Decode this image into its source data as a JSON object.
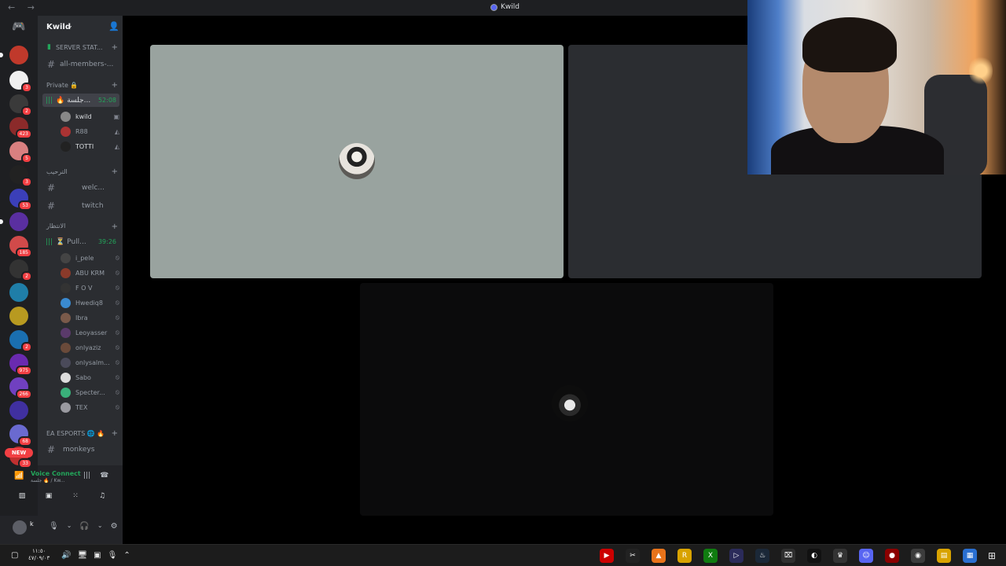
{
  "window": {
    "title": "Kwild",
    "nav": "← →"
  },
  "server": {
    "name": "Kwild"
  },
  "rail": {
    "badges": [
      {
        "count": "3"
      },
      {
        "count": "2"
      },
      {
        "count": "423"
      },
      {
        "count": "5"
      },
      {
        "count": "3"
      },
      {
        "count": "53"
      },
      {
        "count": "185"
      },
      {
        "count": "2"
      },
      {
        "count": "2"
      },
      {
        "count": "975"
      },
      {
        "count": "266"
      },
      {
        "count": "68"
      },
      {
        "count": "33"
      }
    ],
    "new_label": "NEW",
    "new_count": "12"
  },
  "sidebar": {
    "channels": {
      "server_stats": "SERVER STAT...",
      "all_members": "all-members-...",
      "private_category": "Private 🔒",
      "voice_active": {
        "name": "🔥 جلسة...",
        "timer": "52:08"
      },
      "members_a": [
        {
          "name": "kwild"
        },
        {
          "name": "R88"
        },
        {
          "name": "TOTTI"
        }
      ],
      "arabic_category": "الترحيب",
      "welcome": "welc...",
      "twitch": "twitch",
      "waiting_category": "الانتظار",
      "voice_pull": {
        "name": "⏳ Pull...",
        "timer": "39:26"
      },
      "members_b": [
        {
          "name": "i_pele"
        },
        {
          "name": "ABU KRM"
        },
        {
          "name": "F O V"
        },
        {
          "name": "Hwediq8"
        },
        {
          "name": "Ibra"
        },
        {
          "name": "Leoyasser"
        },
        {
          "name": "onlyaziz"
        },
        {
          "name": "onlysalm..."
        },
        {
          "name": "Sabo"
        },
        {
          "name": "Specter..."
        },
        {
          "name": "TEX"
        }
      ],
      "ea_category": "EA ESPORTS 🌐 🔥",
      "monkeys": "monkeys"
    },
    "voice_panel": {
      "status": "Voice Connect",
      "location": "جلسة 🔥 / Kw..."
    },
    "user_panel": {
      "name": "k"
    }
  },
  "taskbar": {
    "time": "١١:٥٠",
    "date": "٤٧/٠٩/٠٣"
  },
  "colors": {
    "accent": "#5865f2",
    "voice_green": "#23a55a",
    "badge_red": "#f23f43",
    "sidebar_bg": "#2b2d31"
  }
}
